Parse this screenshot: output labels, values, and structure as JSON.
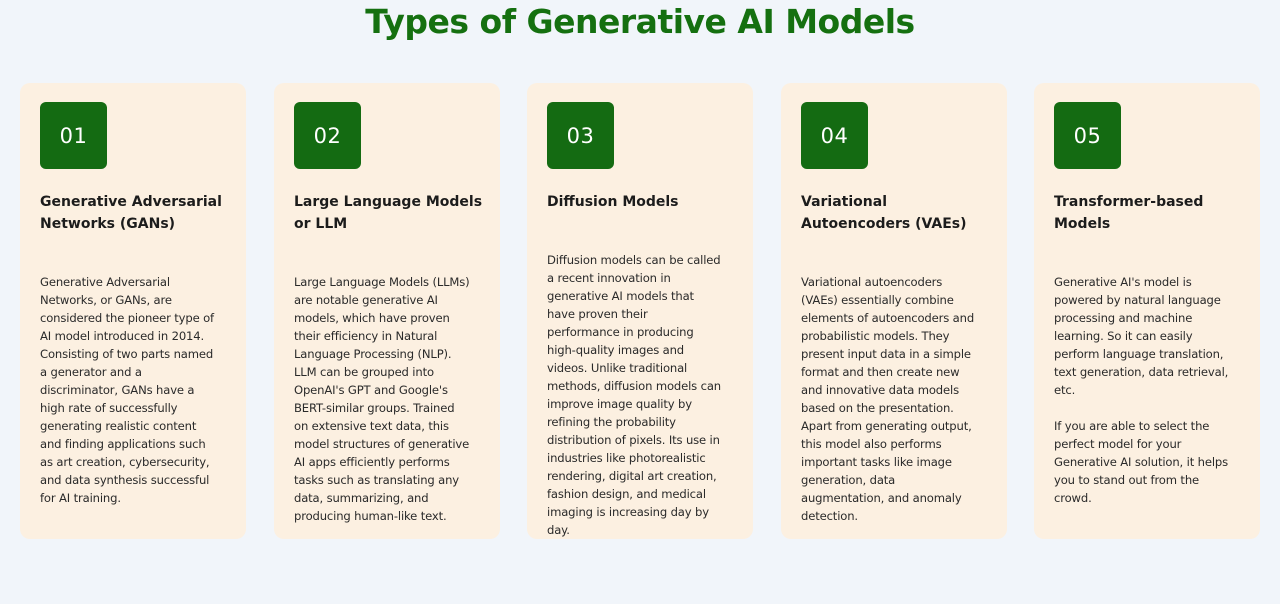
{
  "title": "Types of Generative AI Models",
  "colors": {
    "title": "#157010",
    "badge_bg": "#146b12",
    "card_bg": "#fcf0e1",
    "page_bg": "#f1f5fa"
  },
  "cards": [
    {
      "number": "01",
      "heading": "Generative Adversarial\nNetworks (GANs)",
      "description": "Generative Adversarial\nNetworks, or GANs, are\nconsidered the pioneer type of\nAI model introduced in 2014.\nConsisting of two parts named\na generator and a\ndiscriminator, GANs have a\nhigh rate of successfully\ngenerating realistic content\nand finding applications such\nas art creation, cybersecurity,\nand data synthesis successful\nfor AI training.",
      "description_2": ""
    },
    {
      "number": "02",
      "heading": "Large Language Models\nor LLM",
      "description": "Large Language Models (LLMs)\nare notable generative AI\nmodels, which have proven\ntheir efficiency in Natural\nLanguage Processing (NLP).\nLLM can be grouped into\nOpenAI's GPT and Google's\nBERT-similar groups. Trained\non extensive text data, this\nmodel structures of generative\nAI apps efficiently performs\ntasks such as translating any\ndata, summarizing, and\nproducing human-like text.",
      "description_2": ""
    },
    {
      "number": "03",
      "heading": "Diffusion Models",
      "description": "Diffusion models can be called\na recent innovation in\ngenerative AI models that\nhave proven their\nperformance in producing\nhigh-quality images and\nvideos. Unlike traditional\nmethods, diffusion models can\nimprove image quality by\nrefining the probability\ndistribution of pixels. Its use in\nindustries like photorealistic\nrendering, digital art creation,\nfashion design, and medical\nimaging is increasing day by\nday.",
      "description_2": ""
    },
    {
      "number": "04",
      "heading": "Variational\nAutoencoders (VAEs)",
      "description": "Variational autoencoders\n(VAEs) essentially combine\nelements of autoencoders and\nprobabilistic models. They\npresent input data in a simple\nformat and then create new\nand innovative data models\nbased on the presentation.\nApart from generating output,\nthis model also performs\nimportant tasks like image\ngeneration, data\naugmentation, and anomaly\ndetection.",
      "description_2": ""
    },
    {
      "number": "05",
      "heading": "Transformer-based\nModels",
      "description": "Generative AI's model is\npowered by natural language\nprocessing and machine\nlearning. So it can easily\nperform language translation,\ntext generation, data retrieval,\netc.",
      "description_2": "If you are able to select the\nperfect model for your\nGenerative AI solution, it helps\nyou to stand out from the\ncrowd."
    }
  ]
}
